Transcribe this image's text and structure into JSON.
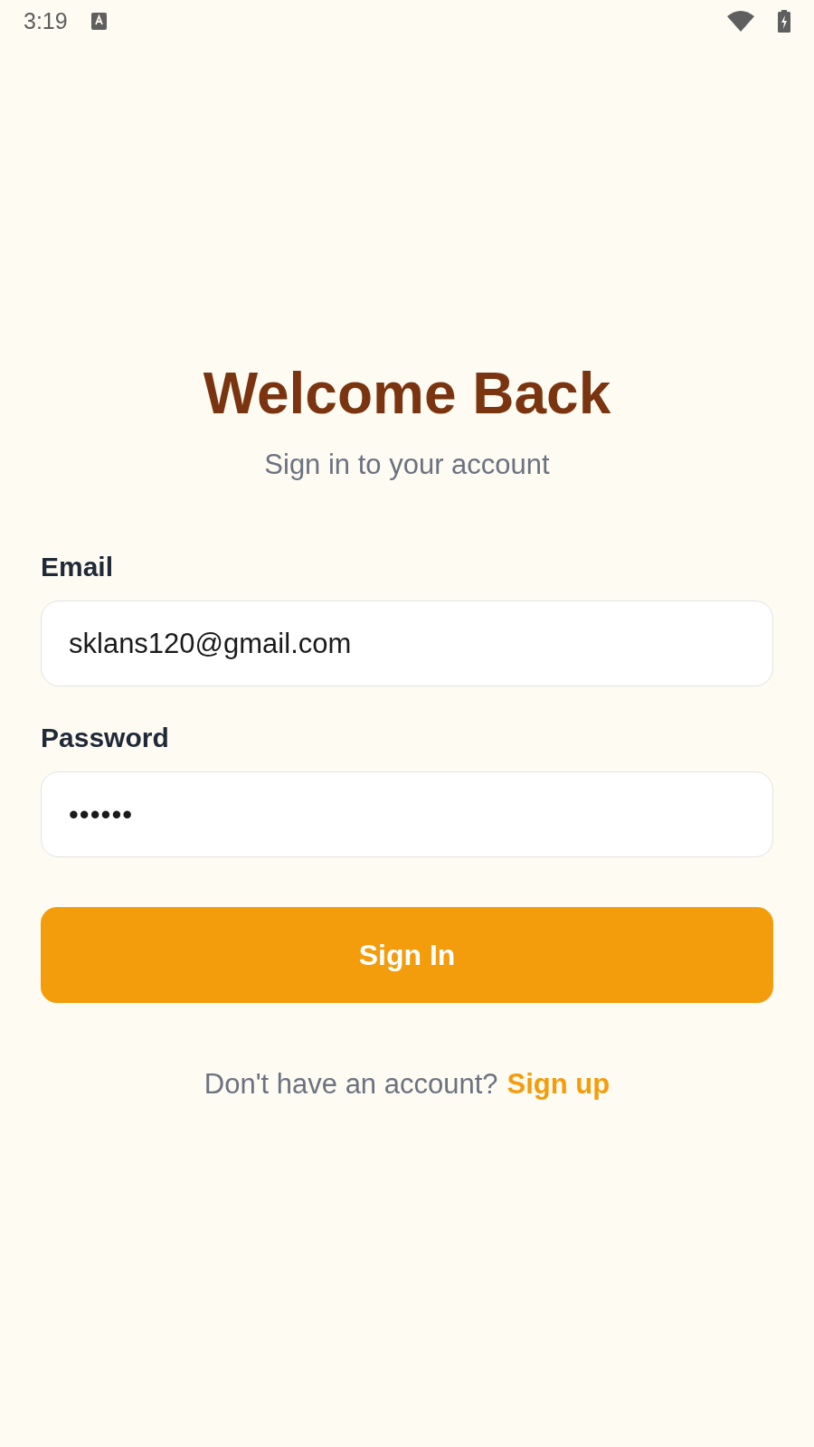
{
  "status_bar": {
    "time": "3:19"
  },
  "header": {
    "title": "Welcome Back",
    "subtitle": "Sign in to your account"
  },
  "form": {
    "fields": [
      {
        "label": "Email",
        "value": "sklans120@gmail.com",
        "kind": "text"
      },
      {
        "label": "Password",
        "value": "••••••",
        "kind": "password"
      }
    ],
    "submit": "Sign In"
  },
  "footer": {
    "prompt": "Don't have an account?",
    "link": "Sign up"
  }
}
